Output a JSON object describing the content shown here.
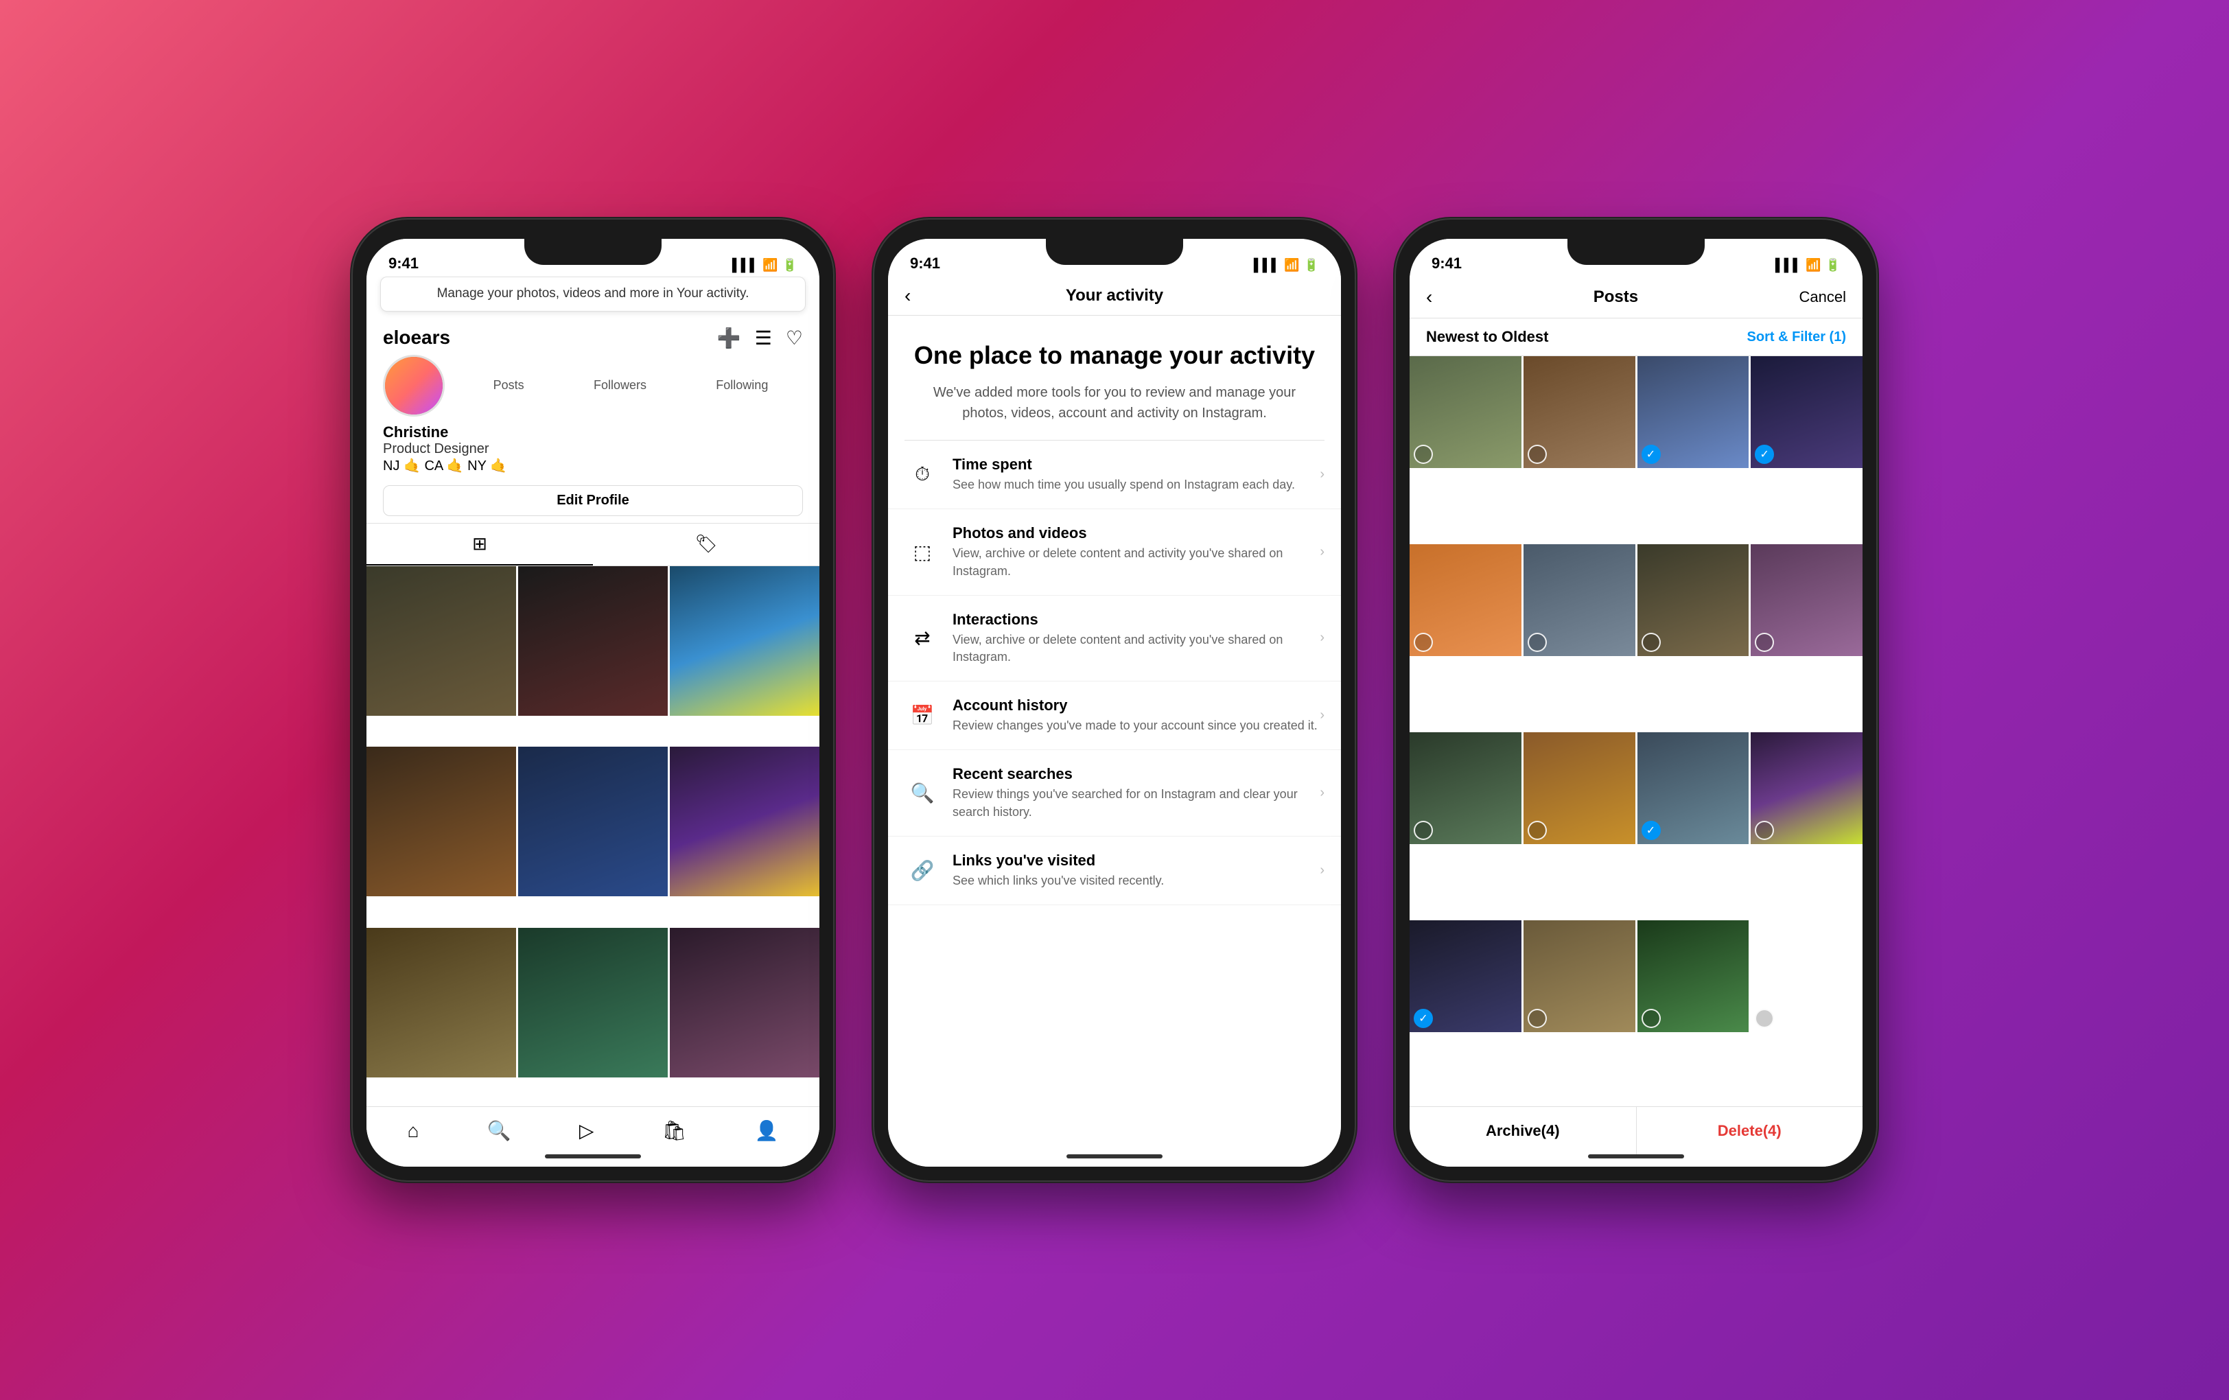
{
  "background": "gradient-pink-purple",
  "phones": [
    {
      "id": "phone1",
      "screen": "profile",
      "status_bar": {
        "time": "9:41",
        "icons": [
          "signal",
          "wifi",
          "battery"
        ]
      },
      "tooltip": {
        "text": "Manage your photos, videos and more in Your activity."
      },
      "header": {
        "username": "eloears",
        "icons": [
          "add-icon",
          "menu-icon",
          "heart-icon"
        ]
      },
      "stats": {
        "posts": {
          "count": "",
          "label": "Posts"
        },
        "followers": {
          "count": "",
          "label": "Followers"
        },
        "following": {
          "count": "",
          "label": "Following"
        }
      },
      "profile": {
        "name": "Christine",
        "bio": "Product Designer",
        "location": "NJ 🤙 CA 🤙 NY 🤙"
      },
      "edit_profile_btn": "Edit Profile",
      "tabs": [
        {
          "label": "grid-icon",
          "active": true
        },
        {
          "label": "tag-icon",
          "active": false
        }
      ],
      "grid_photos": [
        "sg1",
        "sg2",
        "sg3",
        "sg4",
        "sg5",
        "sg6",
        "sg7",
        "sg8",
        "sg9"
      ],
      "bottom_nav": [
        "home-icon",
        "search-icon",
        "reels-icon",
        "shop-icon",
        "profile-icon"
      ]
    },
    {
      "id": "phone2",
      "screen": "activity",
      "status_bar": {
        "time": "9:41",
        "icons": [
          "signal",
          "wifi",
          "battery"
        ]
      },
      "header": {
        "title": "Your activity",
        "back": "‹"
      },
      "hero": {
        "title": "One place to manage your activity",
        "description": "We've added more tools for you to review and manage your photos, videos, account and activity on Instagram."
      },
      "items": [
        {
          "icon": "clock-icon",
          "title": "Time spent",
          "description": "See how much time you usually spend on Instagram each day."
        },
        {
          "icon": "media-icon",
          "title": "Photos and videos",
          "description": "View, archive or delete content and activity you've shared on Instagram."
        },
        {
          "icon": "interactions-icon",
          "title": "Interactions",
          "description": "View, archive or delete content and activity you've shared on Instagram."
        },
        {
          "icon": "calendar-icon",
          "title": "Account history",
          "description": "Review changes you've made to your account since you created it."
        },
        {
          "icon": "search-icon",
          "title": "Recent searches",
          "description": "Review things you've searched for on Instagram and clear your search history."
        },
        {
          "icon": "link-icon",
          "title": "Links you've visited",
          "description": "See which links you've visited recently."
        }
      ]
    },
    {
      "id": "phone3",
      "screen": "posts",
      "status_bar": {
        "time": "9:41",
        "icons": [
          "signal",
          "wifi",
          "battery"
        ]
      },
      "header": {
        "back": "‹",
        "title": "Posts",
        "cancel": "Cancel"
      },
      "filter": {
        "sort_label": "Newest to Oldest",
        "sort_filter": "Sort & Filter (1)"
      },
      "grid_photos": [
        "pg1",
        "pg2",
        "pg3",
        "pg4",
        "pg5",
        "pg6",
        "pg7",
        "pg8",
        "pg9",
        "pg10",
        "pg11",
        "pg12",
        "pg13",
        "pg14",
        "pg15",
        "pg16"
      ],
      "checked_indices": [
        2,
        3,
        10,
        12
      ],
      "bottom_bar": {
        "archive": "Archive(4)",
        "delete": "Delete(4)"
      }
    }
  ]
}
